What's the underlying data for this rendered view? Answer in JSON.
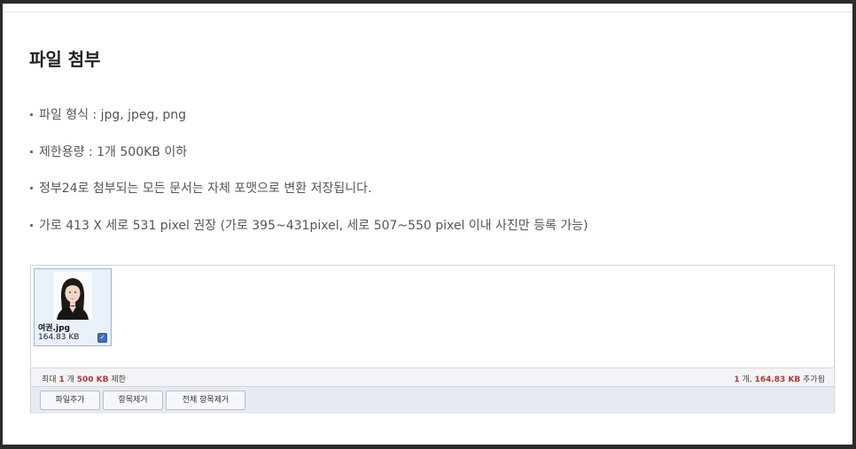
{
  "title": "파일 첨부",
  "bullets": [
    "파일 형식 : jpg, jpeg, png",
    "제한용량 : 1개 500KB 이하",
    "정부24로 첨부되는 모든 문서는 자체 포맷으로 변환 저장됩니다.",
    "가로 413 X 세로 531 pixel 권장 (가로 395~431pixel, 세로 507~550 pixel 이내 사진만 등록 가능)"
  ],
  "uploader": {
    "file": {
      "name": "여권.jpg",
      "size": "164.83 KB",
      "checked": true
    },
    "status_left": {
      "prefix": "최대",
      "count": "1",
      "count_unit": "개",
      "limit": "500 KB",
      "suffix": "제한"
    },
    "status_right": {
      "count": "1",
      "count_unit": "개,",
      "size": "164.83 KB",
      "suffix": "추가됨"
    },
    "buttons": {
      "add": "파일추가",
      "remove": "항목제거",
      "remove_all": "전체 항목제거"
    }
  },
  "colors": {
    "accent_red": "#b03a2e",
    "thumb_bg": "#eaf1fb",
    "button_bar_bg": "#e6eaf2"
  },
  "icons": {
    "file_checkbox": "checkbox-checked-icon"
  }
}
